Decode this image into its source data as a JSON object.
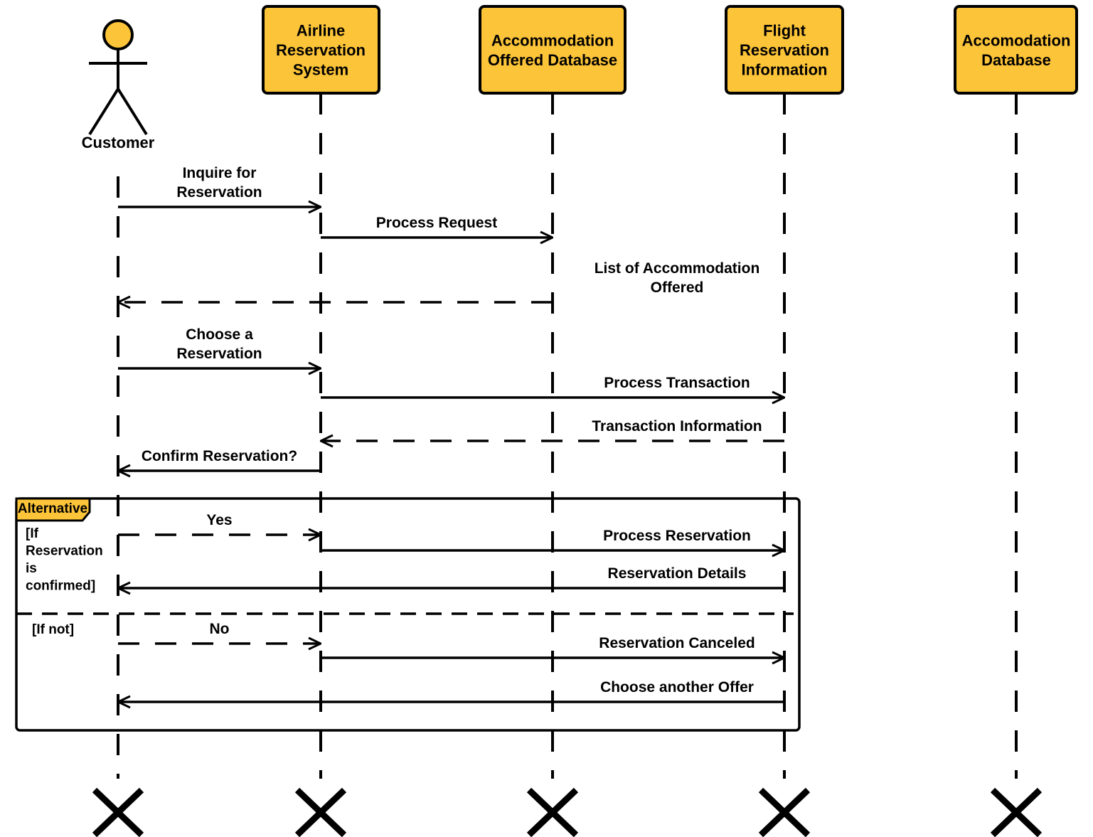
{
  "diagram": {
    "type": "UML sequence diagram",
    "colors": {
      "participant_fill": "#FCC438",
      "stroke": "#000000",
      "background": "#FFFFFF"
    },
    "participants": [
      {
        "id": "customer",
        "kind": "actor",
        "label": [
          "Customer"
        ]
      },
      {
        "id": "airline",
        "kind": "object",
        "label": [
          "Airline",
          "Reservation",
          "System"
        ]
      },
      {
        "id": "accom_offered",
        "kind": "object",
        "label": [
          "Accommodation",
          "Offered Database"
        ]
      },
      {
        "id": "flight",
        "kind": "object",
        "label": [
          "Flight",
          "Reservation",
          "Information"
        ]
      },
      {
        "id": "accom_db",
        "kind": "object",
        "label": [
          "Accomodation",
          "Database"
        ]
      }
    ],
    "messages": [
      {
        "from": "customer",
        "to": "airline",
        "style": "sync",
        "label": [
          "Inquire for",
          "Reservation"
        ]
      },
      {
        "from": "airline",
        "to": "accom_offered",
        "style": "sync",
        "label": [
          "Process Request"
        ]
      },
      {
        "from": "accom_offered",
        "to": "customer",
        "style": "return",
        "label": [
          "List of Accommodation",
          "Offered"
        ]
      },
      {
        "from": "customer",
        "to": "airline",
        "style": "sync",
        "label": [
          "Choose a",
          "Reservation"
        ]
      },
      {
        "from": "airline",
        "to": "flight",
        "style": "sync",
        "label": [
          "Process Transaction"
        ]
      },
      {
        "from": "flight",
        "to": "airline",
        "style": "return",
        "label": [
          "Transaction Information"
        ]
      },
      {
        "from": "airline",
        "to": "customer",
        "style": "sync",
        "label": [
          "Confirm Reservation?"
        ]
      },
      {
        "from": "customer",
        "to": "airline",
        "style": "return",
        "label": [
          "Yes"
        ],
        "fragment_operand": 0
      },
      {
        "from": "airline",
        "to": "flight",
        "style": "sync",
        "label": [
          "Process Reservation"
        ],
        "fragment_operand": 0
      },
      {
        "from": "flight",
        "to": "customer",
        "style": "sync",
        "label": [
          "Reservation Details"
        ],
        "fragment_operand": 0
      },
      {
        "from": "customer",
        "to": "airline",
        "style": "return",
        "label": [
          "No"
        ],
        "fragment_operand": 1
      },
      {
        "from": "airline",
        "to": "flight",
        "style": "sync",
        "label": [
          "Reservation Canceled"
        ],
        "fragment_operand": 1
      },
      {
        "from": "flight",
        "to": "customer",
        "style": "sync",
        "label": [
          "Choose another Offer"
        ],
        "fragment_operand": 1
      }
    ],
    "fragment": {
      "operator": "Alternative",
      "operands": [
        {
          "guard": [
            "[If",
            "Reservation",
            "is",
            "confirmed]"
          ]
        },
        {
          "guard": [
            "[If not]"
          ]
        }
      ]
    },
    "destruction_marks": [
      "customer",
      "airline",
      "accom_offered",
      "flight",
      "accom_db"
    ]
  }
}
